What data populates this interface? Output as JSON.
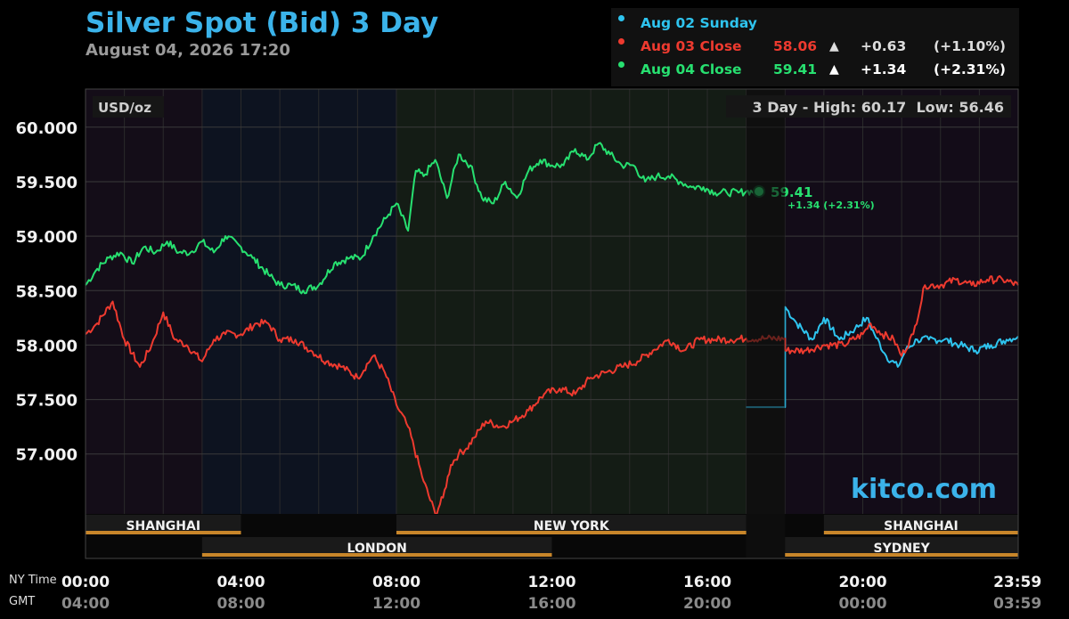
{
  "header": {
    "title": "Silver Spot (Bid) 3 Day",
    "timestamp": "August 04, 2026 17:20"
  },
  "legend": [
    {
      "label": "Aug 02 Sunday",
      "value": "",
      "arrow": "",
      "change": "",
      "pct": "",
      "color": "#2ec4ef"
    },
    {
      "label": "Aug 03 Close",
      "value": "58.06",
      "arrow": "▲",
      "change": "+0.63",
      "pct": "(+1.10%)",
      "color": "#ee3a2f"
    },
    {
      "label": "Aug 04 Close",
      "value": "59.41",
      "arrow": "▲",
      "change": "+1.34",
      "pct": "(+2.31%)",
      "color": "#27e070"
    }
  ],
  "watermark": "kitco.com",
  "chart_data": {
    "type": "line",
    "title": "Silver Spot (Bid) 3 Day",
    "unit_label": "USD/oz",
    "range_label": "3 Day - High: 60.17  Low: 56.46",
    "ylim": [
      56.45,
      60.35
    ],
    "yticks": [
      "60.000",
      "59.500",
      "59.000",
      "58.500",
      "58.000",
      "57.500",
      "57.000"
    ],
    "ytick_values": [
      60.0,
      59.5,
      59.0,
      58.5,
      58.0,
      57.5,
      57.0
    ],
    "x_unit": "NY time (hours)",
    "xlim": [
      0,
      24
    ],
    "xrow_labels": [
      "NY Time",
      "GMT"
    ],
    "xticks_ny": [
      "00:00",
      "04:00",
      "08:00",
      "12:00",
      "16:00",
      "20:00",
      "23:59"
    ],
    "xticks_gmt": [
      "04:00",
      "08:00",
      "12:00",
      "16:00",
      "20:00",
      "00:00",
      "03:59"
    ],
    "xtick_values": [
      0,
      4,
      8,
      12,
      16,
      20,
      23.98
    ],
    "sessions_top": [
      {
        "name": "SHANGHAI",
        "start": 0,
        "end": 4
      },
      {
        "name": "NEW YORK",
        "start": 8,
        "end": 17
      },
      {
        "name": "SHANGHAI",
        "start": 19,
        "end": 24
      }
    ],
    "sessions_bottom": [
      {
        "name": "LONDON",
        "start": 3,
        "end": 12
      },
      {
        "name": "SYDNEY",
        "start": 18,
        "end": 24
      }
    ],
    "market_closed": [
      17,
      18
    ],
    "current": {
      "x": 17.33,
      "y": 59.41,
      "label": "59.41",
      "change": "+1.34 (+2.31%)"
    },
    "series": [
      {
        "name": "Aug 02 Sunday",
        "color": "#2ec4ef",
        "x": [
          17,
          18,
          18,
          18.3,
          18.7,
          19,
          19.4,
          19.8,
          20.1,
          20.3,
          20.6,
          20.9,
          21.1,
          21.4,
          21.7,
          22.1,
          22.5,
          22.9,
          23.3,
          23.7,
          24
        ],
        "y": [
          57.43,
          57.43,
          58.35,
          58.2,
          58.05,
          58.25,
          58.05,
          58.15,
          58.25,
          58.1,
          57.9,
          57.8,
          57.95,
          58.05,
          58.05,
          58.05,
          58.0,
          57.95,
          58.0,
          58.05,
          58.08
        ]
      },
      {
        "name": "Aug 03 Close",
        "color": "#ee3a2f",
        "x": [
          0,
          0.3,
          0.7,
          1.0,
          1.4,
          1.7,
          2.0,
          2.3,
          2.6,
          3.0,
          3.3,
          3.6,
          4.0,
          4.4,
          4.7,
          5.0,
          5.4,
          5.8,
          6.2,
          6.6,
          7.0,
          7.4,
          7.7,
          8.0,
          8.3,
          8.7,
          9.0,
          9.2,
          9.4,
          9.6,
          9.8,
          10.0,
          10.3,
          10.7,
          11.0,
          11.4,
          11.8,
          12.2,
          12.6,
          13.0,
          13.4,
          13.8,
          14.2,
          14.6,
          15.0,
          15.4,
          15.8,
          16.2,
          16.6,
          17.0,
          17.5,
          18.0,
          18.0,
          18.5,
          19.0,
          19.5,
          20.0,
          20.2,
          20.5,
          20.8,
          21.0,
          21.3,
          21.6,
          22.0,
          22.4,
          22.8,
          23.2,
          23.6,
          24.0
        ],
        "y": [
          58.1,
          58.2,
          58.4,
          58.05,
          57.8,
          58.0,
          58.3,
          58.05,
          58.0,
          57.85,
          58.05,
          58.1,
          58.1,
          58.2,
          58.2,
          58.05,
          58.05,
          57.95,
          57.85,
          57.8,
          57.7,
          57.9,
          57.75,
          57.45,
          57.25,
          56.75,
          56.45,
          56.6,
          56.9,
          57.0,
          57.05,
          57.15,
          57.3,
          57.25,
          57.3,
          57.4,
          57.55,
          57.6,
          57.55,
          57.7,
          57.75,
          57.8,
          57.85,
          57.95,
          58.05,
          57.95,
          58.05,
          58.05,
          58.05,
          58.06,
          58.06,
          58.06,
          57.95,
          57.95,
          58.0,
          58.0,
          58.1,
          58.2,
          58.1,
          58.05,
          57.9,
          58.1,
          58.55,
          58.55,
          58.6,
          58.55,
          58.6,
          58.6,
          58.55
        ]
      },
      {
        "name": "Aug 04 Close",
        "color": "#27e070",
        "x": [
          0,
          0.3,
          0.6,
          0.9,
          1.2,
          1.5,
          1.8,
          2.1,
          2.4,
          2.7,
          3.0,
          3.3,
          3.6,
          4.0,
          4.3,
          4.7,
          5.0,
          5.3,
          5.6,
          6.0,
          6.4,
          6.8,
          7.1,
          7.4,
          7.8,
          8.0,
          8.3,
          8.5,
          8.7,
          9.0,
          9.3,
          9.6,
          9.9,
          10.2,
          10.5,
          10.8,
          11.1,
          11.4,
          11.7,
          12.0,
          12.3,
          12.6,
          12.9,
          13.2,
          13.5,
          13.8,
          14.1,
          14.4,
          14.7,
          15.0,
          15.3,
          15.6,
          15.9,
          16.2,
          16.5,
          16.8,
          17.0,
          17.33
        ],
        "y": [
          58.55,
          58.7,
          58.8,
          58.85,
          58.75,
          58.9,
          58.85,
          58.95,
          58.85,
          58.85,
          58.95,
          58.85,
          59.0,
          58.9,
          58.8,
          58.65,
          58.55,
          58.55,
          58.5,
          58.55,
          58.75,
          58.8,
          58.8,
          59.0,
          59.2,
          59.3,
          59.05,
          59.6,
          59.55,
          59.7,
          59.35,
          59.75,
          59.65,
          59.35,
          59.3,
          59.5,
          59.35,
          59.6,
          59.7,
          59.65,
          59.65,
          59.8,
          59.7,
          59.85,
          59.75,
          59.65,
          59.65,
          59.5,
          59.55,
          59.55,
          59.5,
          59.45,
          59.45,
          59.4,
          59.4,
          59.4,
          59.41,
          59.41
        ]
      }
    ]
  }
}
